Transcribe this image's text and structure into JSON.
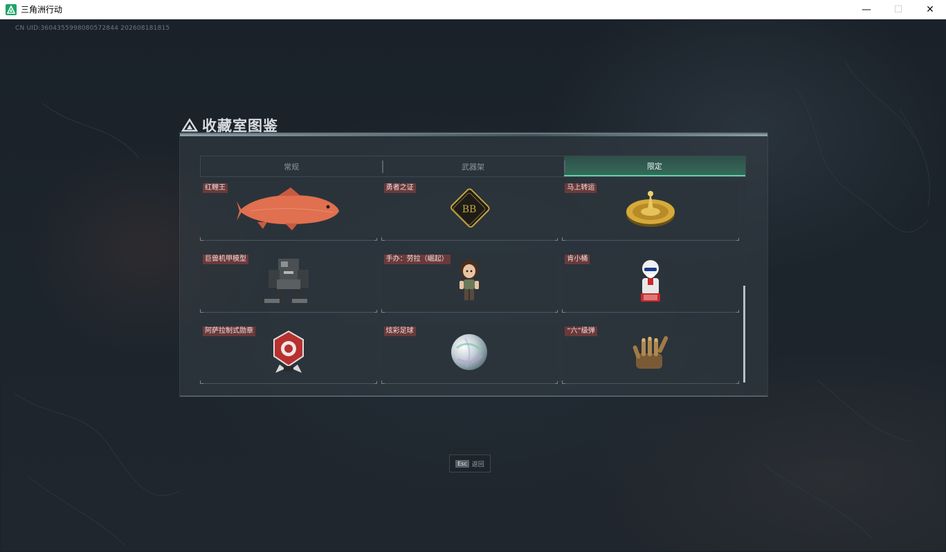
{
  "window": {
    "title": "三角洲行动",
    "minimize_glyph": "—",
    "maximize_glyph": "☐",
    "close_glyph": "✕",
    "app_icon": "delta-triangle-icon"
  },
  "hud": {
    "uid": "CN UID:3604355998080572844 202608181815"
  },
  "panel": {
    "title": "收藏室图鉴",
    "tabs": [
      {
        "label": "常规",
        "active": false
      },
      {
        "label": "武器架",
        "active": false
      },
      {
        "label": "限定",
        "active": true
      }
    ],
    "items": [
      {
        "label": "红鲤王",
        "icon": "red-carp-icon"
      },
      {
        "label": "勇者之证",
        "icon": "brave-badge-icon"
      },
      {
        "label": "马上转运",
        "icon": "golden-roulette-icon"
      },
      {
        "label": "巨兽机甲模型",
        "icon": "mech-model-icon"
      },
      {
        "label": "手办：劳拉（崛起）",
        "icon": "lara-figure-icon"
      },
      {
        "label": "肯小桶",
        "icon": "colonel-figure-icon"
      },
      {
        "label": "阿萨拉制式勋章",
        "icon": "medal-icon"
      },
      {
        "label": "炫彩足球",
        "icon": "iridescent-ball-icon"
      },
      {
        "label": "“六”级弹",
        "icon": "bullet-hand-icon"
      }
    ]
  },
  "footer": {
    "esc_key": "Esc",
    "esc_label": "返回"
  },
  "colors": {
    "active_tab": "#356a5a",
    "active_tab_underline": "#5fd3a6",
    "label_bg": "#6a3a3a"
  }
}
